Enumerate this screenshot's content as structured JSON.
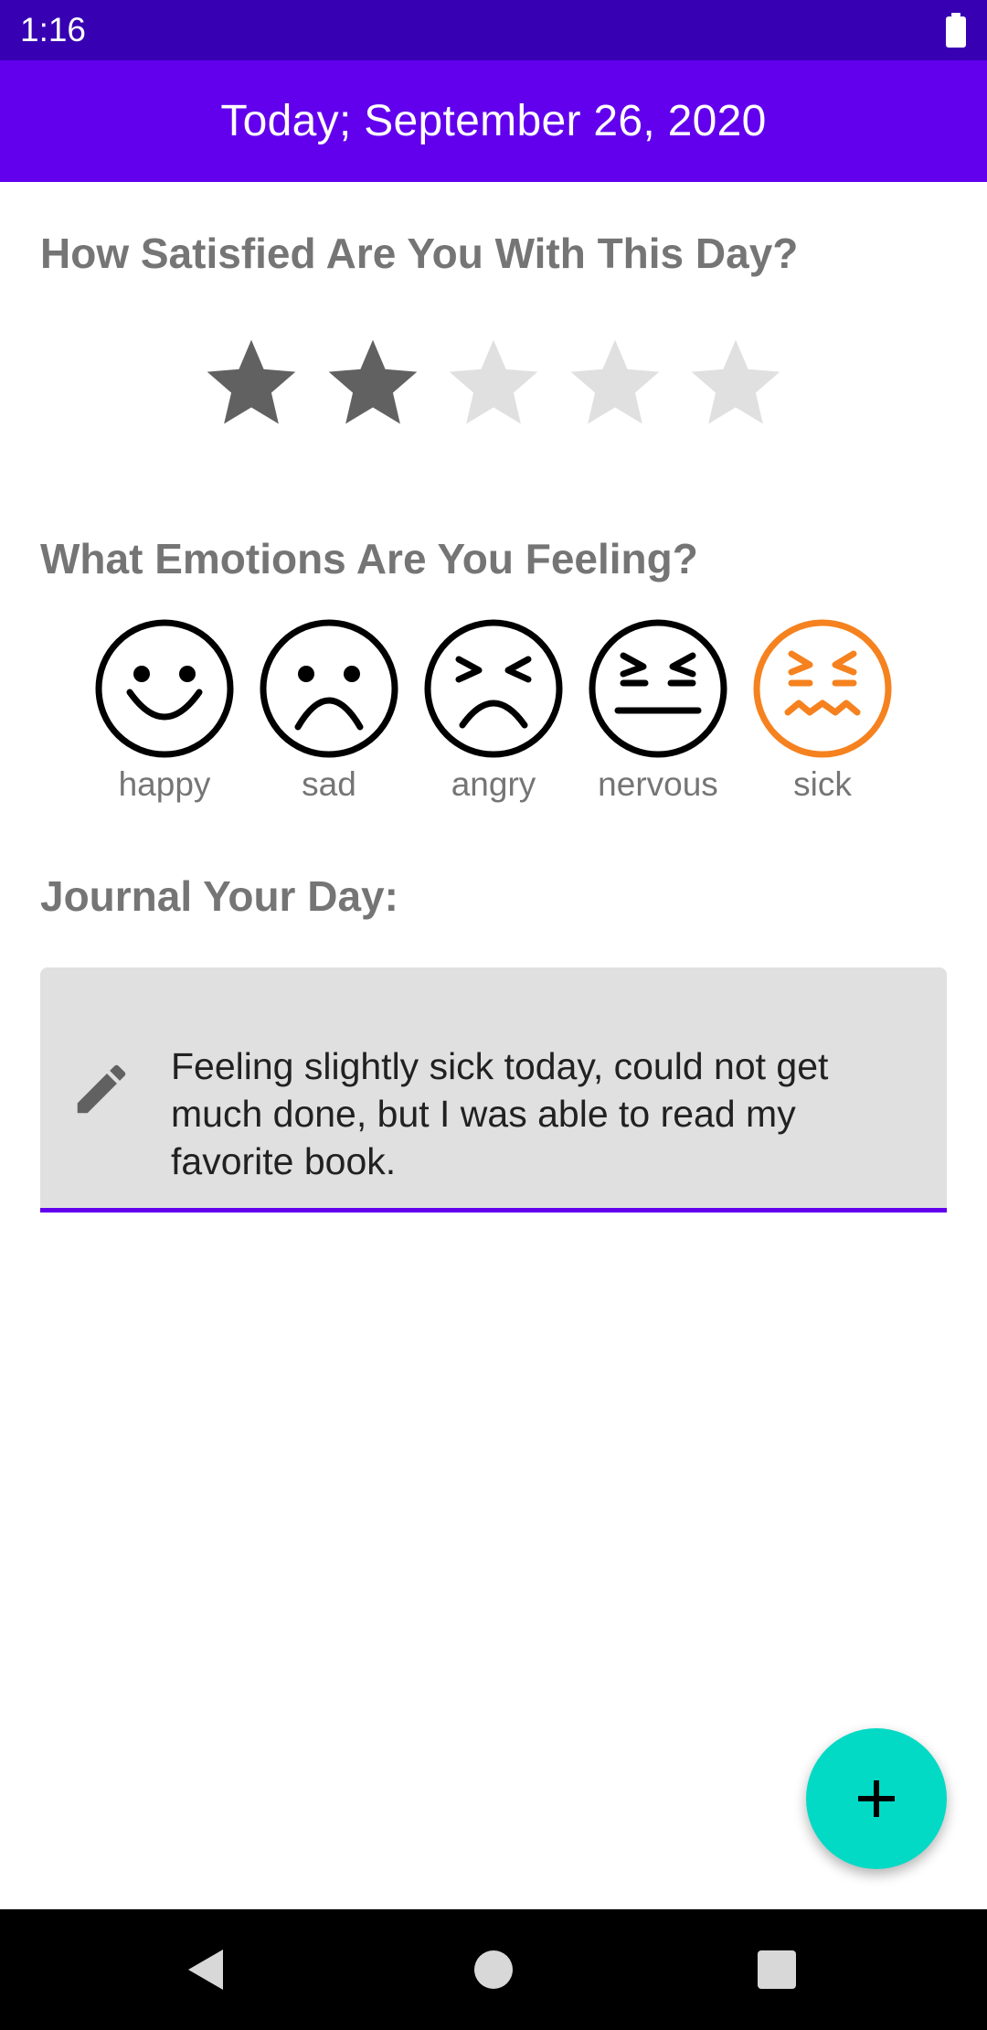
{
  "status_bar": {
    "time": "1:16",
    "battery_icon": "battery-full-icon"
  },
  "app_bar": {
    "title": "Today; September 26, 2020",
    "color": "#6200ee"
  },
  "rating": {
    "heading": "How Satisfied Are You With This Day?",
    "value": 2,
    "max": 5,
    "filled_color": "#616161",
    "empty_color": "#e0e0e0"
  },
  "emotions": {
    "heading": "What Emotions Are You Feeling?",
    "selected": "sick",
    "selected_color": "#f5821f",
    "items": [
      {
        "label": "happy",
        "icon": "happy-face-icon"
      },
      {
        "label": "sad",
        "icon": "sad-face-icon"
      },
      {
        "label": "angry",
        "icon": "angry-face-icon"
      },
      {
        "label": "nervous",
        "icon": "nervous-face-icon"
      },
      {
        "label": "sick",
        "icon": "sick-face-icon"
      }
    ]
  },
  "journal": {
    "heading": "Journal Your Day:",
    "icon": "pencil-icon",
    "text": "Feeling slightly sick today, could not get much done, but I was able to read my favorite book.",
    "underline_color": "#6200ee"
  },
  "fab": {
    "icon": "plus-icon",
    "color": "#03dac5"
  },
  "nav_bar": {
    "back_icon": "back-triangle-icon",
    "home_icon": "home-circle-icon",
    "recents_icon": "recents-square-icon"
  }
}
